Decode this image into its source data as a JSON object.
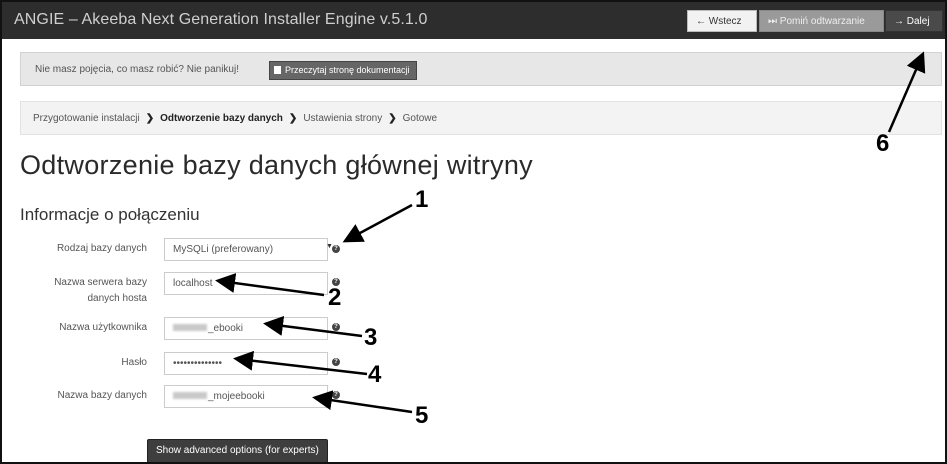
{
  "window": {
    "title": "ANGIE – Akeeba Next Generation Installer Engine v.5.1.0"
  },
  "nav": {
    "back_label": "← Wstecz",
    "skip_label": "⏭ Pomiń odtwarzanie",
    "next_label": "→ Dalej"
  },
  "alert": {
    "text": "Nie masz pojęcia, co masz robić? Nie panikuj!",
    "button_label": "Przeczytaj stronę dokumentacji",
    "close_label": "×"
  },
  "breadcrumb": {
    "steps": [
      "Przygotowanie instalacji",
      "Odtworzenie bazy danych",
      "Ustawienia strony",
      "Gotowe"
    ],
    "active_index": 1
  },
  "page": {
    "title": "Odtworzenie bazy danych głównej witryny",
    "section_title": "Informacje o połączeniu"
  },
  "form": {
    "db_type": {
      "label": "Rodzaj bazy danych",
      "value": "MySQLi (preferowany)"
    },
    "db_host": {
      "label": "Nazwa serwera bazy danych hosta",
      "value": "localhost"
    },
    "db_user": {
      "label": "Nazwa użytkownika",
      "value": "_ebooki"
    },
    "db_pass": {
      "label": "Hasło",
      "value": "••••••••••••••"
    },
    "db_name": {
      "label": "Nazwa bazy danych",
      "value": "_mojeebooki"
    },
    "help_glyph": "?",
    "advanced_button": "Show advanced options (for experts)"
  },
  "annotations": [
    "1",
    "2",
    "3",
    "4",
    "5",
    "6"
  ]
}
